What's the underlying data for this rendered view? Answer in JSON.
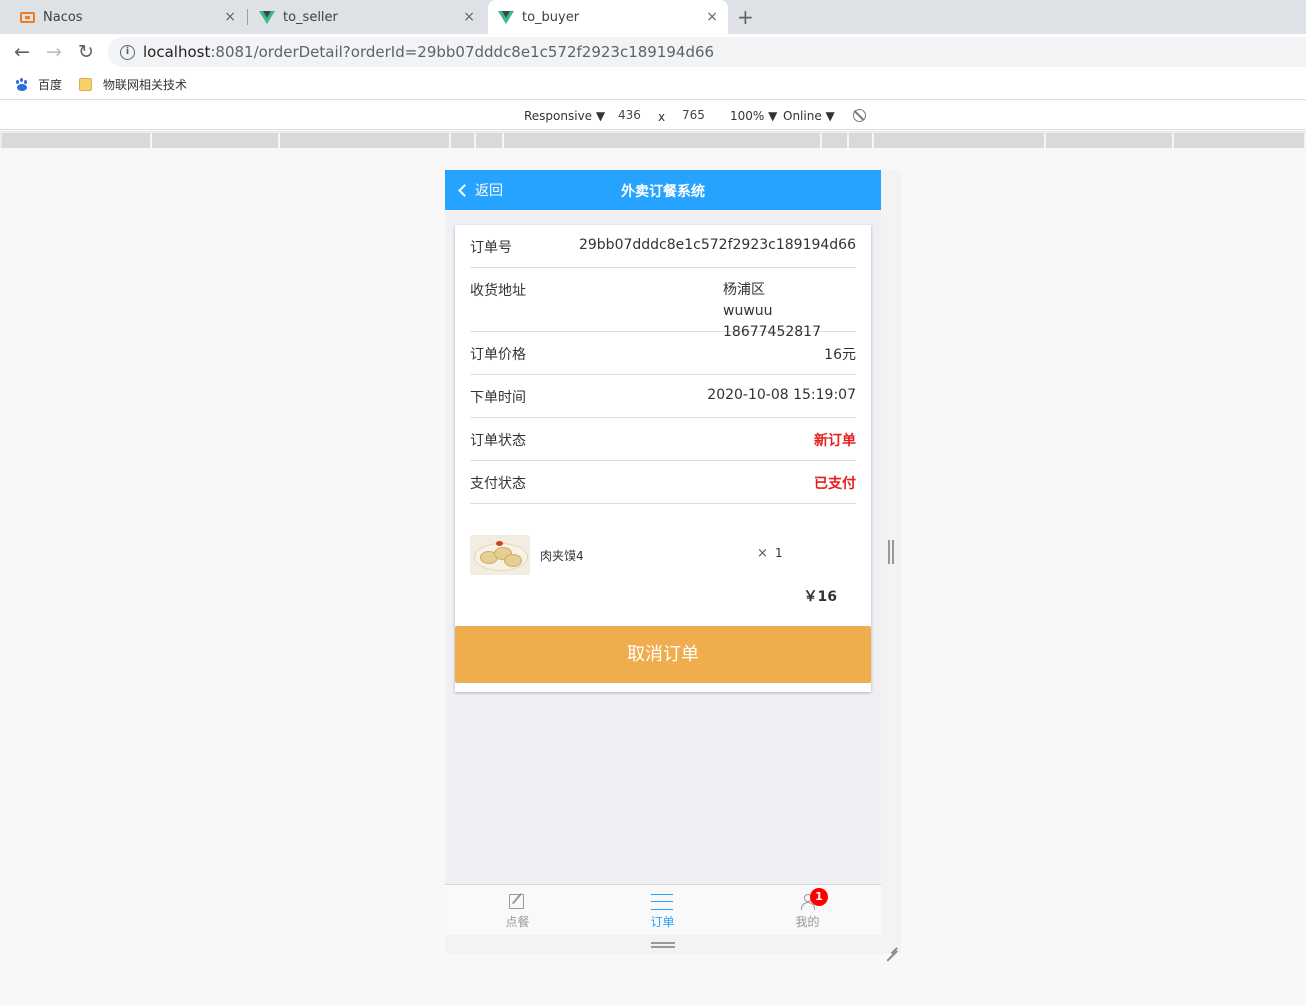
{
  "browser": {
    "tabs": [
      {
        "title": "Nacos",
        "icon": "nacos-icon",
        "close": "×"
      },
      {
        "title": "to_seller",
        "icon": "vue-icon",
        "close": "×"
      },
      {
        "title": "to_buyer",
        "icon": "vue-icon",
        "close": "×"
      }
    ],
    "new_tab": "+",
    "nav": {
      "back": "←",
      "forward": "→",
      "reload": "↻"
    },
    "url": {
      "host": "localhost",
      "rest": ":8081/orderDetail?orderId=29bb07dddc8e1c572f2923c189194d66",
      "info_glyph": "i"
    },
    "bookmarks": [
      {
        "label": "百度",
        "icon": "baidu-paw-icon"
      },
      {
        "label": "物联网相关技术",
        "icon": "folder-icon"
      }
    ]
  },
  "devtools": {
    "device": "Responsive ▼",
    "width": "436",
    "times": "x",
    "height": "765",
    "zoom": "100% ▼",
    "network": "Online ▼"
  },
  "app": {
    "header": {
      "back_label": "返回",
      "title": "外卖订餐系统"
    },
    "order": {
      "rows": [
        {
          "label": "订单号",
          "value": "29bb07dddc8e1c572f2923c189194d66"
        },
        {
          "label": "收货地址",
          "value_line1": "杨浦区",
          "value_line2": "wuwuu 18677452817"
        },
        {
          "label": "订单价格",
          "value": "16元"
        },
        {
          "label": "下单时间",
          "value": "2020-10-08 15:19:07"
        },
        {
          "label": "订单状态",
          "value": "新订单"
        },
        {
          "label": "支付状态",
          "value": "已支付"
        }
      ],
      "item": {
        "name": "肉夹馍4",
        "times": "×",
        "quantity": "1"
      },
      "total": "￥16",
      "cancel_label": "取消订单"
    },
    "tabbar": {
      "items": [
        {
          "label": "点餐",
          "icon": "edit-icon"
        },
        {
          "label": "订单",
          "icon": "list-icon"
        },
        {
          "label": "我的",
          "icon": "user-icon",
          "badge": "1"
        }
      ]
    },
    "colors": {
      "header": "#26a2ff",
      "cancel_button": "#efad4d",
      "status_red": "#e61e1e",
      "badge": "#ff0000"
    }
  }
}
